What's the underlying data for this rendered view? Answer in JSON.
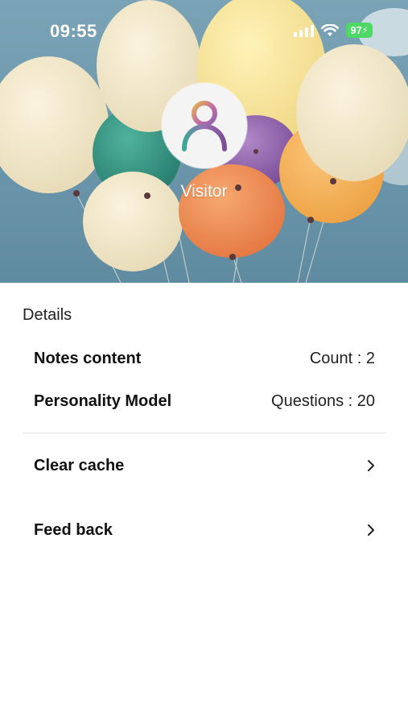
{
  "status_bar": {
    "time": "09:55",
    "battery": "97",
    "icons": [
      "signal-icon",
      "wifi-icon",
      "battery-charging-icon"
    ]
  },
  "profile": {
    "avatar_icon": "person-avatar-icon",
    "name": "Visitor"
  },
  "details": {
    "title": "Details",
    "rows": [
      {
        "label": "Notes content",
        "value": "Count : 2"
      },
      {
        "label": "Personality Model",
        "value": "Questions : 20"
      }
    ]
  },
  "menu": [
    {
      "label": "Clear cache",
      "icon": "chevron-right-icon"
    },
    {
      "label": "Feed back",
      "icon": "chevron-right-icon"
    }
  ],
  "colors": {
    "sky": "#6e98ac",
    "battery": "#4cd964",
    "avatar_purple": "#9b6fb0",
    "avatar_gold": "#e2b64a",
    "avatar_teal": "#3fa79a"
  }
}
